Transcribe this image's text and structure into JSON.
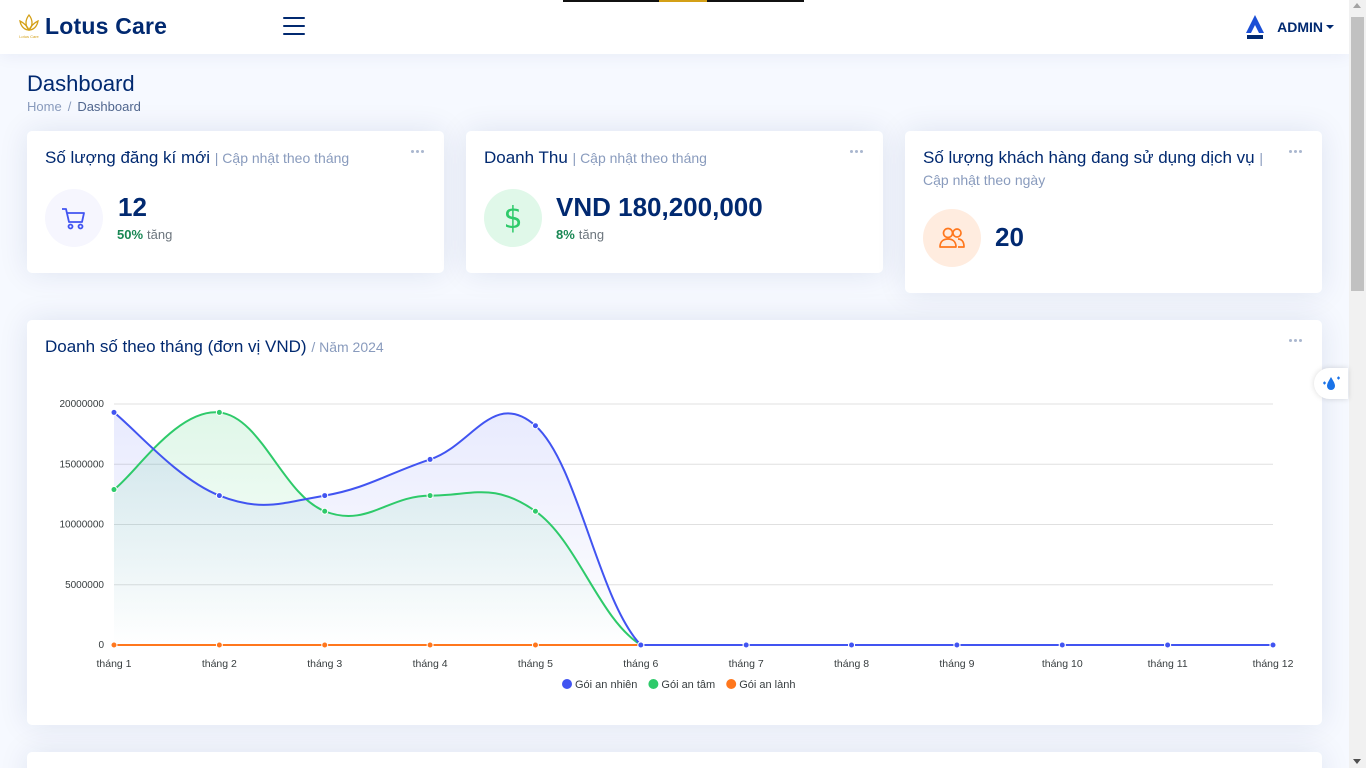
{
  "app": {
    "brand": "Lotus Care",
    "logo_small_text": "Lotus Care"
  },
  "header": {
    "user": "ADMIN",
    "icons": [
      "menu-icon",
      "lotus-logo-icon",
      "profile-logo-icon"
    ]
  },
  "page": {
    "title": "Dashboard",
    "breadcrumb": [
      "Home",
      "Dashboard"
    ]
  },
  "cards": [
    {
      "title": "Số lượng đăng kí mới",
      "subtitle": "| Cập nhật theo tháng",
      "value": "12",
      "change_pct": "50%",
      "change_text": "tăng",
      "icon": "cart-icon",
      "icon_color": "#4154f1",
      "icon_bg": "#f6f6fe"
    },
    {
      "title": "Doanh Thu",
      "subtitle": "| Cập nhật theo tháng",
      "value": "VND 180,200,000",
      "change_pct": "8%",
      "change_text": "tăng",
      "icon": "dollar-icon",
      "icon_color": "#2eca6a",
      "icon_bg": "#e0f8e9"
    },
    {
      "title": "Số lượng khách hàng đang sử dụng dịch vụ",
      "subtitle": "|",
      "subtitle2": "Cập nhật theo ngày",
      "value": "20",
      "icon": "people-icon",
      "icon_color": "#ff771d",
      "icon_bg": "#ffecdf"
    }
  ],
  "sales_chart": {
    "title": "Doanh số theo tháng (đơn vị VND)",
    "subtitle": "/ Năm 2024"
  },
  "chart_data": {
    "type": "area",
    "categories": [
      "tháng 1",
      "tháng 2",
      "tháng 3",
      "tháng 4",
      "tháng 5",
      "tháng 6",
      "tháng 7",
      "tháng 8",
      "tháng 9",
      "tháng 10",
      "tháng 11",
      "tháng 12"
    ],
    "series": [
      {
        "name": "Gói an nhiên",
        "color": "#4154f1",
        "values": [
          19300000,
          12400000,
          12400000,
          15400000,
          18200000,
          0,
          0,
          0,
          0,
          0,
          0,
          0
        ]
      },
      {
        "name": "Gói an tâm",
        "color": "#2eca6a",
        "values": [
          12900000,
          19300000,
          11100000,
          12400000,
          11100000,
          0,
          0,
          0,
          0,
          0,
          0,
          0
        ]
      },
      {
        "name": "Gói an lành",
        "color": "#ff771d",
        "values": [
          0,
          0,
          0,
          0,
          0,
          0,
          0,
          0,
          0,
          0,
          0,
          0
        ]
      }
    ],
    "y_ticks": [
      "0",
      "5000000",
      "10000000",
      "15000000",
      "20000000"
    ],
    "ylim": [
      0,
      20000000
    ],
    "grid": true,
    "legend": "bottom"
  }
}
